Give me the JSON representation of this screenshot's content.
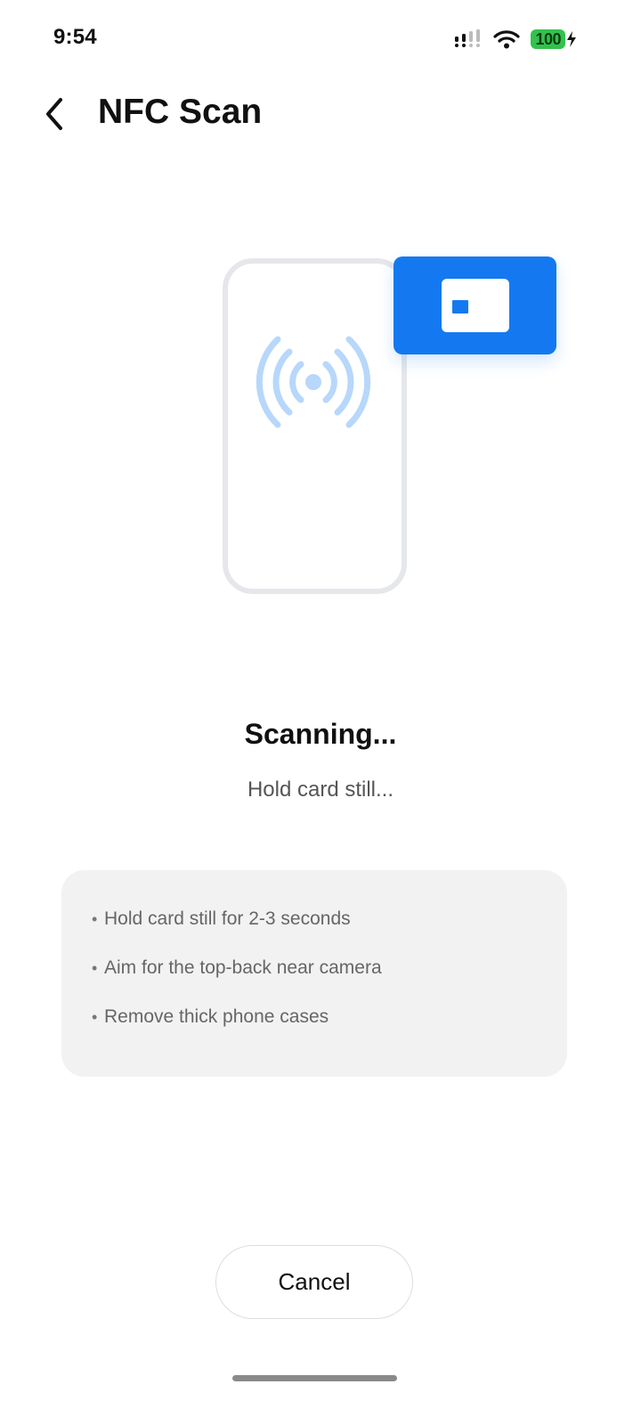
{
  "status_bar": {
    "time": "9:54",
    "battery_level": "100",
    "icons": [
      "cellular-signal-icon",
      "wifi-icon",
      "battery-charging-icon"
    ]
  },
  "header": {
    "back_icon": "chevron-left-icon",
    "title": "NFC Scan"
  },
  "illustration": {
    "icons": [
      "phone-outline-icon",
      "nfc-waves-icon",
      "card-icon"
    ],
    "colors": {
      "accent": "#1479f0",
      "waves": "#b7d7fb",
      "outline": "#e5e7eb"
    }
  },
  "scan_status": {
    "title": "Scanning...",
    "subtitle": "Hold card still..."
  },
  "tips": [
    "Hold card still for 2-3 seconds",
    "Aim for the top-back near camera",
    "Remove thick phone cases"
  ],
  "tip_bullet": "•",
  "actions": {
    "cancel_label": "Cancel"
  },
  "colors": {
    "battery": "#33c24d",
    "tips_background": "#f2f2f3"
  }
}
